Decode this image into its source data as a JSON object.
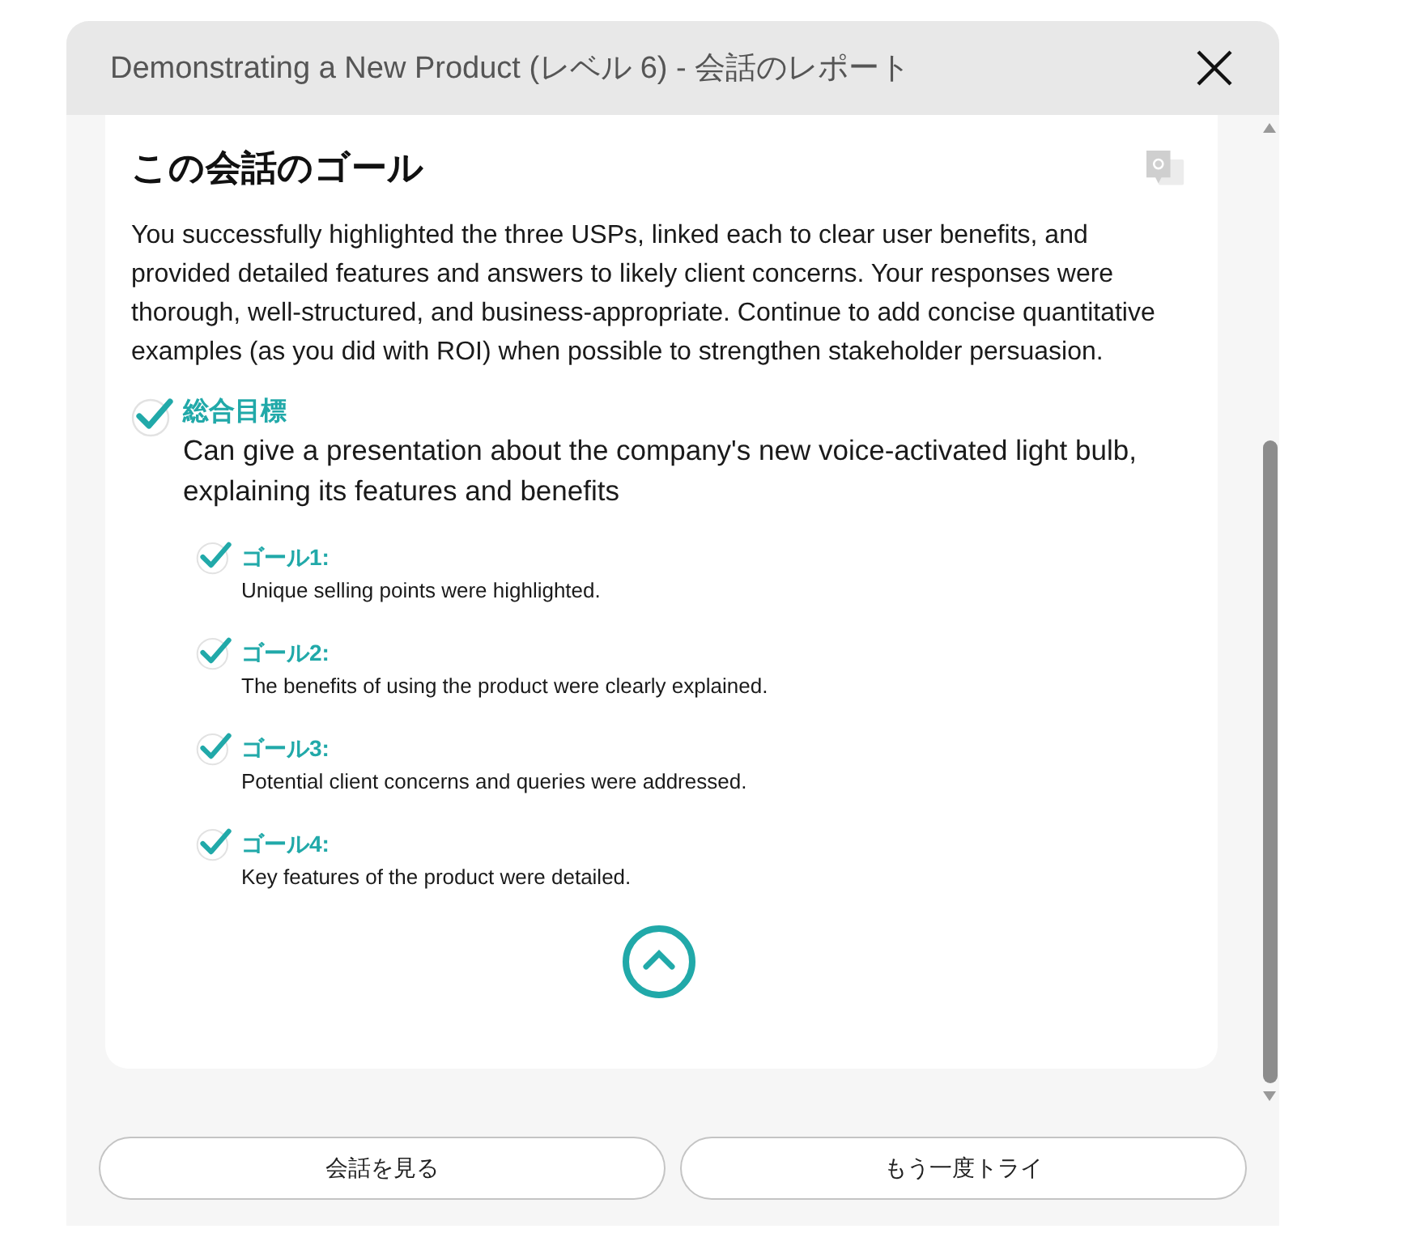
{
  "window": {
    "title": "Demonstrating a New Product (レベル 6) -  会話のレポート"
  },
  "card": {
    "heading": "この会話のゴール",
    "feedback": "You successfully highlighted the three USPs, linked each to clear user benefits, and provided detailed features and answers to likely client concerns. Your responses were thorough, well-structured, and business-appropriate. Continue to add concise quantitative examples (as you did with ROI) when possible to strengthen stakeholder persuasion.",
    "overall": {
      "label": "総合目標",
      "text": "Can give a presentation about the company's new voice-activated light bulb, explaining its features and benefits",
      "checked": true
    },
    "goals": [
      {
        "label": "ゴール1:",
        "text": "Unique selling points were highlighted.",
        "checked": true
      },
      {
        "label": "ゴール2:",
        "text": "The benefits of using the product were clearly explained.",
        "checked": true
      },
      {
        "label": "ゴール3:",
        "text": "Potential client concerns and queries were addressed.",
        "checked": true
      },
      {
        "label": "ゴール4:",
        "text": "Key features of the product were detailed.",
        "checked": true
      }
    ]
  },
  "buttons": [
    "会話を見る",
    "もう一度トライ"
  ]
}
